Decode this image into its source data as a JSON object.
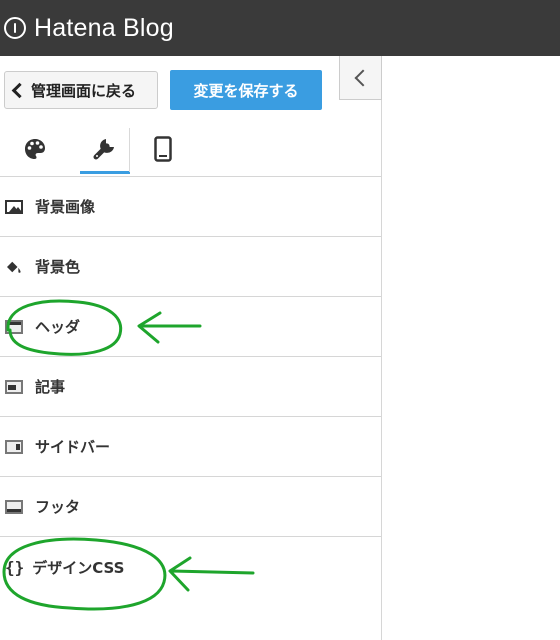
{
  "app": {
    "brand": "Hatena Blog"
  },
  "header": {
    "back_label": "管理画面に戻る",
    "save_label": "変更を保存する"
  },
  "tabs": [
    {
      "name": "design",
      "icon": "palette-icon"
    },
    {
      "name": "customize",
      "icon": "wrench-icon",
      "active": true
    },
    {
      "name": "smartphone",
      "icon": "smartphone-icon"
    }
  ],
  "menu": {
    "items": [
      {
        "label": "背景画像",
        "icon": "image-icon"
      },
      {
        "label": "背景色",
        "icon": "paint-bucket-icon"
      },
      {
        "label": "ヘッダ",
        "icon": "layout-header-icon"
      },
      {
        "label": "記事",
        "icon": "layout-article-icon"
      },
      {
        "label": "サイドバー",
        "icon": "layout-sidebar-icon"
      },
      {
        "label": "フッタ",
        "icon": "layout-footer-icon"
      },
      {
        "label": "デザインCSS",
        "icon": "braces-icon"
      }
    ]
  },
  "colors": {
    "topbar": "#3a3a3a",
    "save_button": "#3a9de1",
    "annotation": "#1ea52c"
  }
}
